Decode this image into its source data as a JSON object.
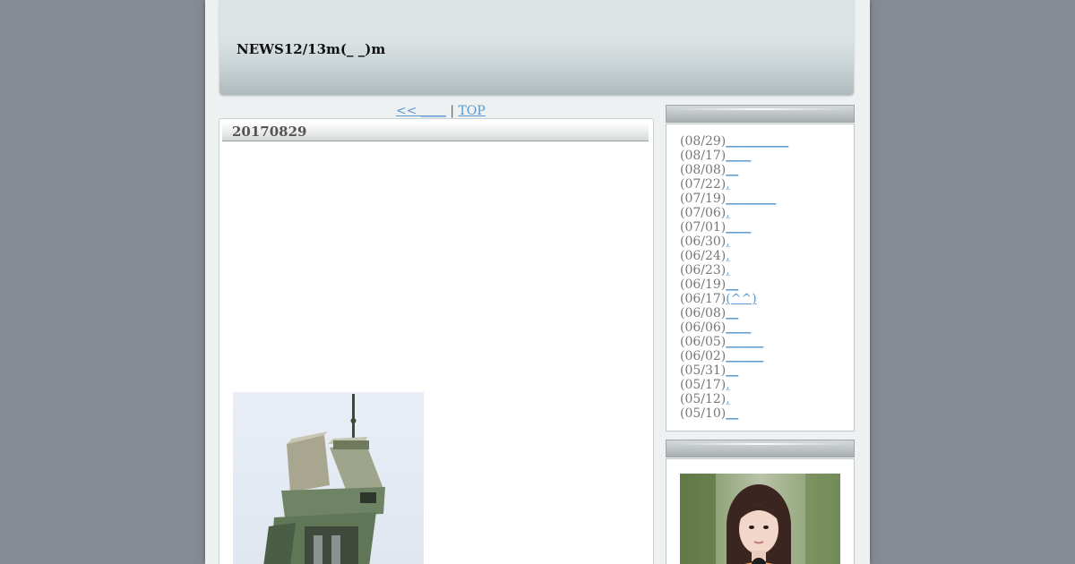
{
  "header": {
    "title": "NEWS12/13m(_ _)m"
  },
  "nav": {
    "prev": "<< ____",
    "separator": "|",
    "top": "TOP"
  },
  "post": {
    "title": "20170829"
  },
  "sidebar": {
    "recent": [
      {
        "date": "(08/29)",
        "link": "__________"
      },
      {
        "date": "(08/17)",
        "link": "____"
      },
      {
        "date": "(08/08)",
        "link": "__"
      },
      {
        "date": "(07/22)",
        "link": ","
      },
      {
        "date": "(07/19)",
        "link": "________"
      },
      {
        "date": "(07/06)",
        "link": ","
      },
      {
        "date": "(07/01)",
        "link": "____"
      },
      {
        "date": "(06/30)",
        "link": ","
      },
      {
        "date": "(06/24)",
        "link": ","
      },
      {
        "date": "(06/23)",
        "link": ","
      },
      {
        "date": "(06/19)",
        "link": "__"
      },
      {
        "date": "(06/17)",
        "link": "(^^)"
      },
      {
        "date": "(06/08)",
        "link": "__"
      },
      {
        "date": "(06/06)",
        "link": "____"
      },
      {
        "date": "(06/05)",
        "link": "______"
      },
      {
        "date": "(06/02)",
        "link": "______"
      },
      {
        "date": "(05/31)",
        "link": "__"
      },
      {
        "date": "(05/17)",
        "link": ","
      },
      {
        "date": "(05/12)",
        "link": ","
      },
      {
        "date": "(05/10)",
        "link": "__"
      }
    ]
  },
  "colors": {
    "background": "#858b95",
    "page": "#edf1f1",
    "link": "#5a97cf"
  }
}
